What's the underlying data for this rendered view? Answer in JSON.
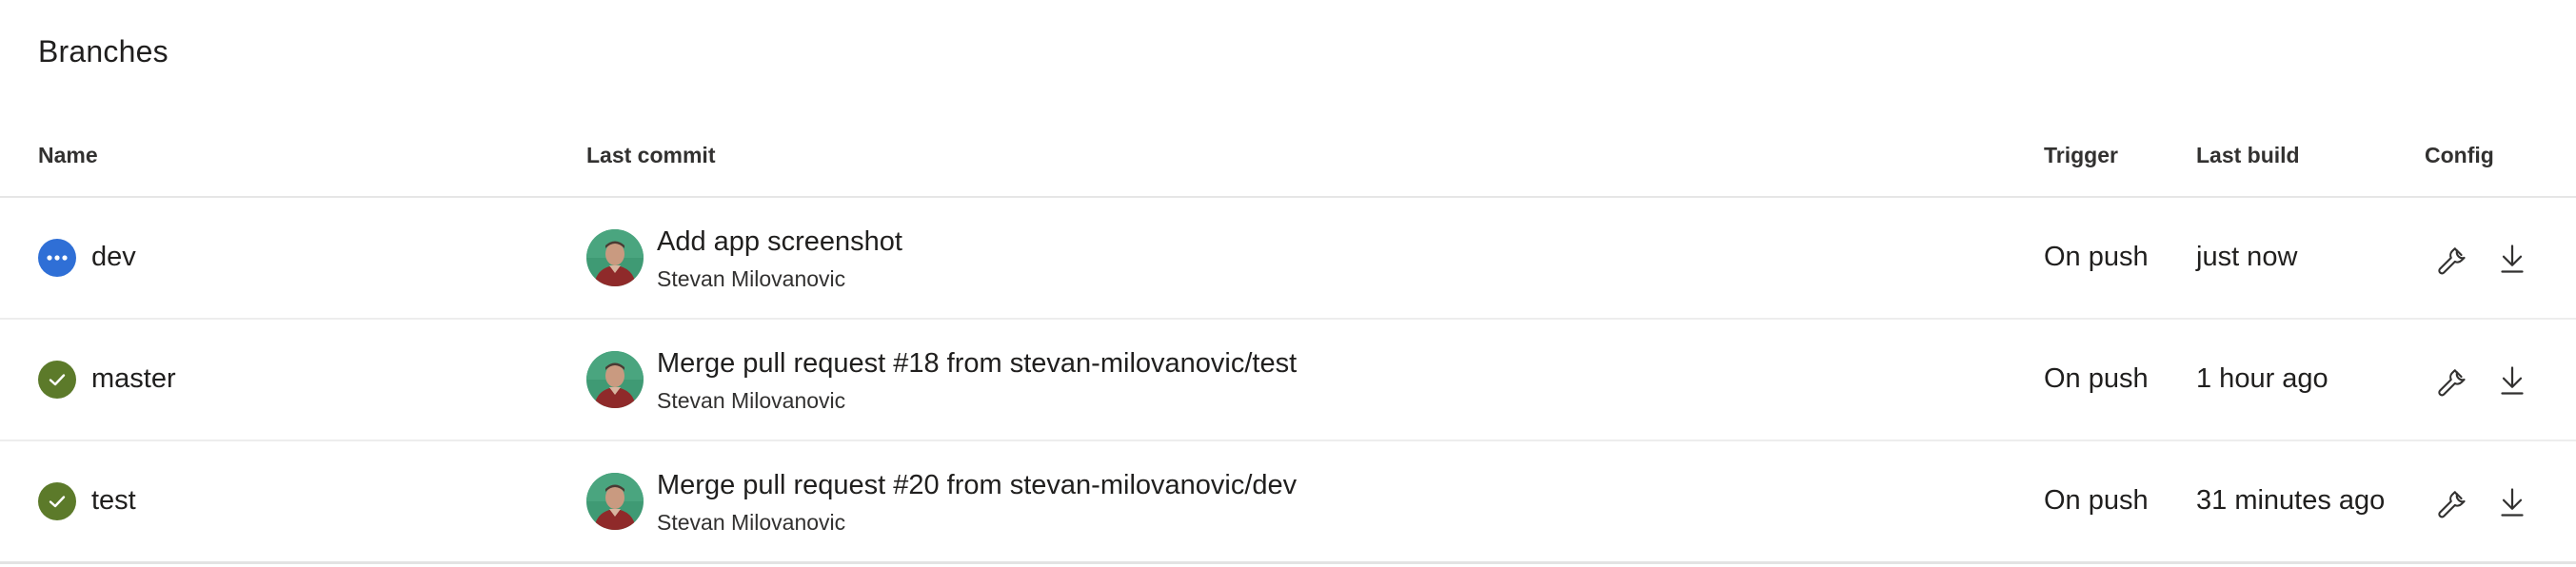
{
  "page": {
    "title": "Branches"
  },
  "columns": {
    "name": "Name",
    "last_commit": "Last commit",
    "trigger": "Trigger",
    "last_build": "Last build",
    "config": "Config"
  },
  "colors": {
    "running": "#2f6fd6",
    "success": "#5c7a2a"
  },
  "rows": [
    {
      "status": "running",
      "status_icon": "ellipsis-icon",
      "branch": "dev",
      "commit_message": "Add app screenshot",
      "commit_author": "Stevan Milovanovic",
      "trigger": "On push",
      "last_build": "just now"
    },
    {
      "status": "success",
      "status_icon": "checkmark-icon",
      "branch": "master",
      "commit_message": "Merge pull request #18 from stevan-milovanovic/test",
      "commit_author": "Stevan Milovanovic",
      "trigger": "On push",
      "last_build": "1 hour ago"
    },
    {
      "status": "success",
      "status_icon": "checkmark-icon",
      "branch": "test",
      "commit_message": "Merge pull request #20 from stevan-milovanovic/dev",
      "commit_author": "Stevan Milovanovic",
      "trigger": "On push",
      "last_build": "31 minutes ago"
    }
  ],
  "config_icons": [
    "wrench-icon",
    "download-icon"
  ]
}
